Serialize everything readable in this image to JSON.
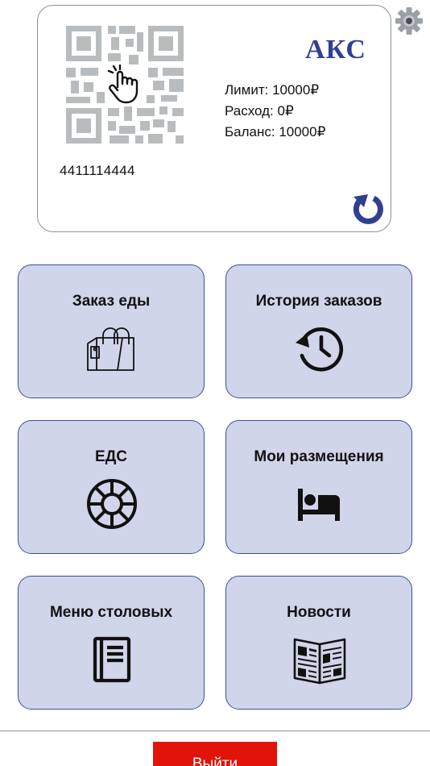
{
  "card": {
    "brand": "АКС",
    "limit": "Лимит: 10000₽",
    "expense": "Расход: 0₽",
    "balance": "Баланс: 10000₽",
    "number": "4411114444"
  },
  "icons": {
    "settings": "gear-icon",
    "qr": "qr-code-icon",
    "tap": "tap-hand-icon",
    "refresh": "refresh-icon"
  },
  "tiles": [
    {
      "label": "Заказ еды",
      "icon": "shopping-bag-icon"
    },
    {
      "label": "История заказов",
      "icon": "history-icon"
    },
    {
      "label": "ЕДС",
      "icon": "lifebuoy-icon"
    },
    {
      "label": "Мои размещения",
      "icon": "bed-icon"
    },
    {
      "label": "Меню столовых",
      "icon": "menu-book-icon"
    },
    {
      "label": "Новости",
      "icon": "newspaper-icon"
    }
  ],
  "logout_label": "Выйти",
  "colors": {
    "tile_bg": "#d1d5ea",
    "tile_border": "#3a4fa0",
    "brand": "#2f3f94",
    "logout_bg": "#e1130a"
  }
}
